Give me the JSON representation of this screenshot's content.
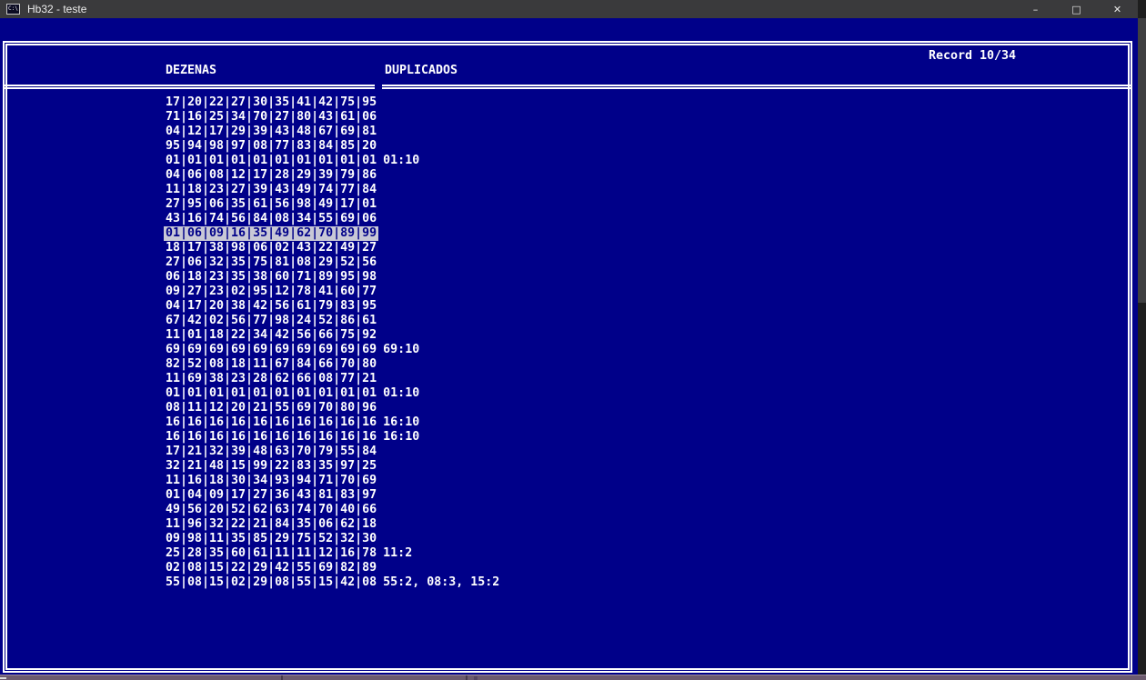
{
  "window": {
    "title": "Hb32 - teste",
    "icon_text": "C:\\",
    "minimize_label": "–",
    "maximize_label": "□",
    "close_label": "✕"
  },
  "header": {
    "record_label": "Record 10/34",
    "columns": {
      "dezenas": "DEZENAS",
      "duplicados": "DUPLICADOS"
    }
  },
  "table": {
    "selected_row": 10,
    "rows": [
      {
        "dezenas": "17|20|22|27|30|35|41|42|75|95",
        "duplicados": ""
      },
      {
        "dezenas": "71|16|25|34|70|27|80|43|61|06",
        "duplicados": ""
      },
      {
        "dezenas": "04|12|17|29|39|43|48|67|69|81",
        "duplicados": ""
      },
      {
        "dezenas": "95|94|98|97|08|77|83|84|85|20",
        "duplicados": ""
      },
      {
        "dezenas": "01|01|01|01|01|01|01|01|01|01",
        "duplicados": "01:10"
      },
      {
        "dezenas": "04|06|08|12|17|28|29|39|79|86",
        "duplicados": ""
      },
      {
        "dezenas": "11|18|23|27|39|43|49|74|77|84",
        "duplicados": ""
      },
      {
        "dezenas": "27|95|06|35|61|56|98|49|17|01",
        "duplicados": ""
      },
      {
        "dezenas": "43|16|74|56|84|08|34|55|69|06",
        "duplicados": ""
      },
      {
        "dezenas": "01|06|09|16|35|49|62|70|89|99",
        "duplicados": ""
      },
      {
        "dezenas": "18|17|38|98|06|02|43|22|49|27",
        "duplicados": ""
      },
      {
        "dezenas": "27|06|32|35|75|81|08|29|52|56",
        "duplicados": ""
      },
      {
        "dezenas": "06|18|23|35|38|60|71|89|95|98",
        "duplicados": ""
      },
      {
        "dezenas": "09|27|23|02|95|12|78|41|60|77",
        "duplicados": ""
      },
      {
        "dezenas": "04|17|20|38|42|56|61|79|83|95",
        "duplicados": ""
      },
      {
        "dezenas": "67|42|02|56|77|98|24|52|86|61",
        "duplicados": ""
      },
      {
        "dezenas": "11|01|18|22|34|42|56|66|75|92",
        "duplicados": ""
      },
      {
        "dezenas": "69|69|69|69|69|69|69|69|69|69",
        "duplicados": "69:10"
      },
      {
        "dezenas": "82|52|08|18|11|67|84|66|70|80",
        "duplicados": ""
      },
      {
        "dezenas": "11|69|38|23|28|62|66|08|77|21",
        "duplicados": ""
      },
      {
        "dezenas": "01|01|01|01|01|01|01|01|01|01",
        "duplicados": "01:10"
      },
      {
        "dezenas": "08|11|12|20|21|55|69|70|80|96",
        "duplicados": ""
      },
      {
        "dezenas": "16|16|16|16|16|16|16|16|16|16",
        "duplicados": "16:10"
      },
      {
        "dezenas": "16|16|16|16|16|16|16|16|16|16",
        "duplicados": "16:10"
      },
      {
        "dezenas": "17|21|32|39|48|63|70|79|55|84",
        "duplicados": ""
      },
      {
        "dezenas": "32|21|48|15|99|22|83|35|97|25",
        "duplicados": ""
      },
      {
        "dezenas": "11|16|18|30|34|93|94|71|70|69",
        "duplicados": ""
      },
      {
        "dezenas": "01|04|09|17|27|36|43|81|83|97",
        "duplicados": ""
      },
      {
        "dezenas": "49|56|20|52|62|63|74|70|40|66",
        "duplicados": ""
      },
      {
        "dezenas": "11|96|32|22|21|84|35|06|62|18",
        "duplicados": ""
      },
      {
        "dezenas": "09|98|11|35|85|29|75|52|32|30",
        "duplicados": ""
      },
      {
        "dezenas": "25|28|35|60|61|11|11|12|16|78",
        "duplicados": "11:2"
      },
      {
        "dezenas": "02|08|15|22|29|42|55|69|82|89",
        "duplicados": ""
      },
      {
        "dezenas": "55|08|15|02|29|08|55|15|42|08",
        "duplicados": "55:2, 08:3, 15:2"
      }
    ]
  },
  "colors": {
    "screen_bg": "#000089",
    "frame": "#ffffff",
    "text": "#ffffff",
    "highlight_bg": "#c8c8d6",
    "highlight_text": "#000089",
    "titlebar_bg": "#3a3a3c",
    "scroll_track": "#1e1e1e",
    "scroll_thumb": "#3f3f41",
    "bottom_strip": "#6c5a6e"
  }
}
